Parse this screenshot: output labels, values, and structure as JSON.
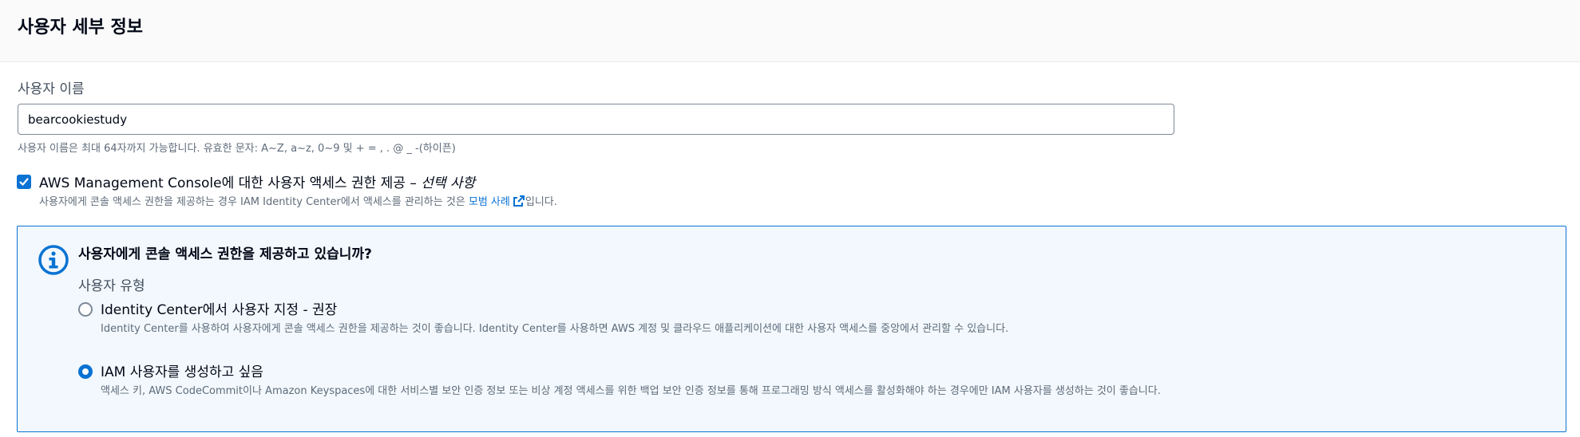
{
  "header": {
    "title": "사용자 세부 정보"
  },
  "user_name": {
    "label": "사용자 이름",
    "value": "bearcookiestudy",
    "hint": "사용자 이름은 최대 64자까지 가능합니다. 유효한 문자: A~Z, a~z, 0~9 및 + = , . @ _ -(하이픈)"
  },
  "console_access": {
    "checked": true,
    "label": "AWS Management Console에 대한 사용자 액세스 권한 제공 – ",
    "label_optional": "선택 사항",
    "desc_prefix": "사용자에게 콘솔 액세스 권한을 제공하는 경우 IAM Identity Center에서 액세스를 관리하는 것은 ",
    "desc_link": "모범 사례",
    "desc_suffix": "입니다."
  },
  "info_box": {
    "title": "사용자에게 콘솔 액세스 권한을 제공하고 있습니까?",
    "user_type_label": "사용자 유형",
    "options": [
      {
        "label": "Identity Center에서 사용자 지정 - 권장",
        "desc": "Identity Center를 사용하여 사용자에게 콘솔 액세스 권한을 제공하는 것이 좋습니다. Identity Center를 사용하면 AWS 계정 및 클라우드 애플리케이션에 대한 사용자 액세스를 중앙에서 관리할 수 있습니다.",
        "selected": false
      },
      {
        "label": "IAM 사용자를 생성하고 싶음",
        "desc": "액세스 키, AWS CodeCommit이나 Amazon Keyspaces에 대한 서비스별 보안 인증 정보 또는 비상 계정 액세스를 위한 백업 보안 인증 정보를 통해 프로그래밍 방식 액세스를 활성화해야 하는 경우에만 IAM 사용자를 생성하는 것이 좋습니다.",
        "selected": true
      }
    ]
  },
  "colors": {
    "accent": "#0972d3",
    "info_bg": "#f2f8fd",
    "text": "#000716",
    "muted": "#5f6b7a"
  },
  "icons": [
    "checkmark-icon",
    "external-link-icon",
    "info-icon"
  ]
}
